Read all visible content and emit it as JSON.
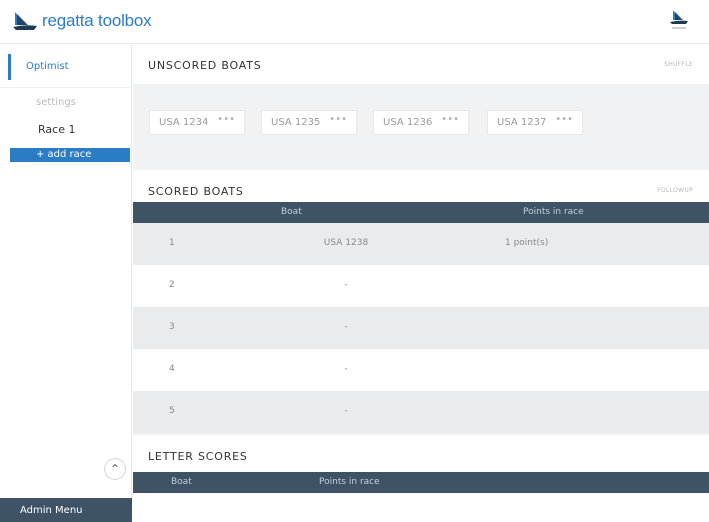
{
  "app": {
    "brand_name": "regatta toolbox",
    "accent_color": "#2a7dc2",
    "header_color": "#3e5466"
  },
  "sidebar": {
    "event_name": "Optimist",
    "settings_label": "settings",
    "race_label": "Race 1",
    "add_race_label": "+ add race",
    "admin_label": "Admin Menu",
    "admin_toggle_icon": "chevron-up-icon"
  },
  "unscored": {
    "title": "UNSCORED BOATS",
    "action_label": "SHUFFLE",
    "boats": [
      {
        "name": "USA 1234",
        "more": "•••"
      },
      {
        "name": "USA 1235",
        "more": "•••"
      },
      {
        "name": "USA 1236",
        "more": "•••"
      },
      {
        "name": "USA 1237",
        "more": "•••"
      }
    ]
  },
  "scored": {
    "title": "SCORED BOATS",
    "action_label": "FOLLOWUP",
    "columns": {
      "boat": "Boat",
      "points": "Points in race"
    },
    "rows": [
      {
        "num": "1",
        "boat": "USA 1238",
        "points": "1 point(s)"
      },
      {
        "num": "2",
        "boat": "-",
        "points": ""
      },
      {
        "num": "3",
        "boat": "-",
        "points": ""
      },
      {
        "num": "4",
        "boat": "-",
        "points": ""
      },
      {
        "num": "5",
        "boat": "-",
        "points": ""
      }
    ]
  },
  "letter": {
    "title": "LETTER SCORES",
    "columns": {
      "boat": "Boat",
      "points": "Points in race"
    }
  }
}
